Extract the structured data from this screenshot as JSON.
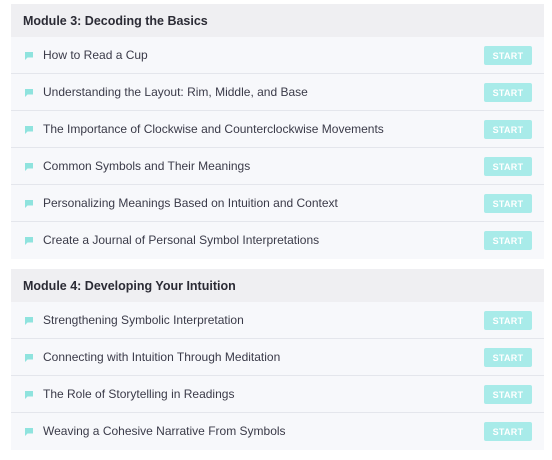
{
  "modules": [
    {
      "title": "Module 3: Decoding the Basics",
      "lessons": [
        {
          "title": "How to Read a Cup",
          "action": "START"
        },
        {
          "title": "Understanding the Layout: Rim, Middle, and Base",
          "action": "START"
        },
        {
          "title": "The Importance of Clockwise and Counterclockwise Movements",
          "action": "START"
        },
        {
          "title": "Common Symbols and Their Meanings",
          "action": "START"
        },
        {
          "title": "Personalizing Meanings Based on Intuition and Context",
          "action": "START"
        },
        {
          "title": "Create a Journal of Personal Symbol Interpretations",
          "action": "START"
        }
      ]
    },
    {
      "title": "Module 4: Developing Your Intuition",
      "lessons": [
        {
          "title": "Strengthening Symbolic Interpretation",
          "action": "START"
        },
        {
          "title": "Connecting with Intuition Through Meditation",
          "action": "START"
        },
        {
          "title": "The Role of Storytelling in Readings",
          "action": "START"
        },
        {
          "title": "Weaving a Cohesive Narrative From Symbols",
          "action": "START"
        }
      ]
    }
  ],
  "icons": {
    "lesson_icon": "lesson-flag-icon"
  },
  "colors": {
    "accent": "#a8ebe9",
    "icon": "#8fe3de",
    "header_bg": "#efeff2",
    "row_bg": "#f7f8fb"
  }
}
